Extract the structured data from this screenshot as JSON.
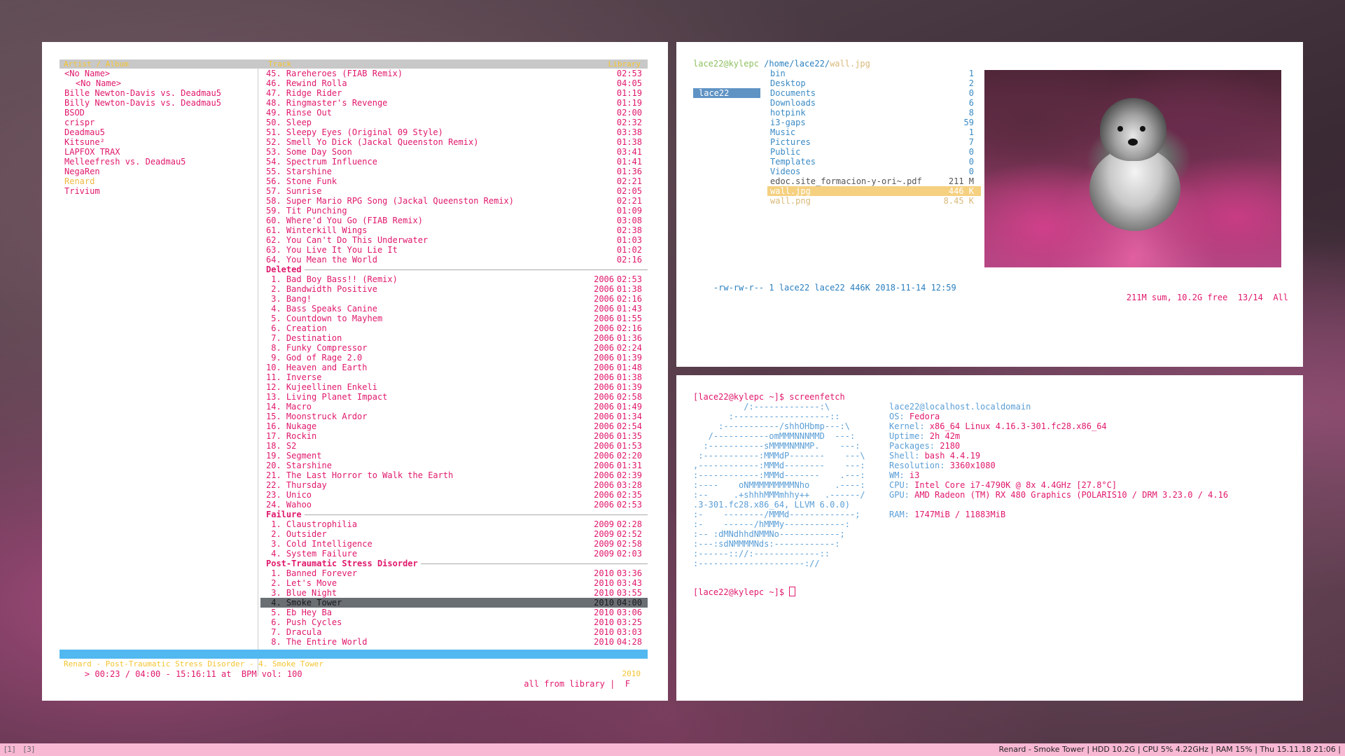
{
  "cmus": {
    "header_left": "Artist / Album",
    "header_mid": "Track",
    "header_right": "Library",
    "artists": [
      {
        "name": "<No Name>",
        "indent": false,
        "selected": false
      },
      {
        "name": "<No Name>",
        "indent": true,
        "selected": false
      },
      {
        "name": "Bille Newton-Davis vs. Deadmau5",
        "indent": false,
        "selected": false
      },
      {
        "name": "Billy Newton-Davis vs. Deadmau5",
        "indent": false,
        "selected": false
      },
      {
        "name": "BSOD",
        "indent": false,
        "selected": false
      },
      {
        "name": "crispr",
        "indent": false,
        "selected": false
      },
      {
        "name": "Deadmau5",
        "indent": false,
        "selected": false
      },
      {
        "name": "Kitsune²",
        "indent": false,
        "selected": false
      },
      {
        "name": "LAPFOX TRAX",
        "indent": false,
        "selected": false
      },
      {
        "name": "Melleefresh vs. Deadmau5",
        "indent": false,
        "selected": false
      },
      {
        "name": "NegaRen",
        "indent": false,
        "selected": false
      },
      {
        "name": "Renard",
        "indent": false,
        "selected": true
      },
      {
        "name": "Trivium",
        "indent": false,
        "selected": false
      }
    ],
    "tracks": [
      {
        "kind": "track",
        "title": "45. Rareheroes (FIAB Remix)",
        "year": "",
        "dur": "02:53"
      },
      {
        "kind": "track",
        "title": "46. Rewind Rolla",
        "year": "",
        "dur": "04:05"
      },
      {
        "kind": "track",
        "title": "47. Ridge Rider",
        "year": "",
        "dur": "01:19"
      },
      {
        "kind": "track",
        "title": "48. Ringmaster's Revenge",
        "year": "",
        "dur": "01:19"
      },
      {
        "kind": "track",
        "title": "49. Rinse Out",
        "year": "",
        "dur": "02:00"
      },
      {
        "kind": "track",
        "title": "50. Sleep",
        "year": "",
        "dur": "02:32"
      },
      {
        "kind": "track",
        "title": "51. Sleepy Eyes (Original 09 Style)",
        "year": "",
        "dur": "03:38"
      },
      {
        "kind": "track",
        "title": "52. Smell Yo Dick (Jackal Queenston Remix)",
        "year": "",
        "dur": "01:38"
      },
      {
        "kind": "track",
        "title": "53. Some Day Soon",
        "year": "",
        "dur": "03:41"
      },
      {
        "kind": "track",
        "title": "54. Spectrum Influence",
        "year": "",
        "dur": "01:41"
      },
      {
        "kind": "track",
        "title": "55. Starshine",
        "year": "",
        "dur": "01:36"
      },
      {
        "kind": "track",
        "title": "56. Stone Funk",
        "year": "",
        "dur": "02:21"
      },
      {
        "kind": "track",
        "title": "57. Sunrise",
        "year": "",
        "dur": "02:05"
      },
      {
        "kind": "track",
        "title": "58. Super Mario RPG Song (Jackal Queenston Remix)",
        "year": "",
        "dur": "02:21"
      },
      {
        "kind": "track",
        "title": "59. Tit Punching",
        "year": "",
        "dur": "01:09"
      },
      {
        "kind": "track",
        "title": "60. Where'd You Go (FIAB Remix)",
        "year": "",
        "dur": "03:08"
      },
      {
        "kind": "track",
        "title": "61. Winterkill Wings",
        "year": "",
        "dur": "02:38"
      },
      {
        "kind": "track",
        "title": "62. You Can't Do This Underwater",
        "year": "",
        "dur": "01:03"
      },
      {
        "kind": "track",
        "title": "63. You Live It You Lie It",
        "year": "",
        "dur": "01:02"
      },
      {
        "kind": "track",
        "title": "64. You Mean the World",
        "year": "",
        "dur": "02:16"
      },
      {
        "kind": "group",
        "title": "Deleted"
      },
      {
        "kind": "track",
        "title": " 1. Bad Boy Bass!! (Remix)",
        "year": "2006",
        "dur": "02:53"
      },
      {
        "kind": "track",
        "title": " 2. Bandwidth Positive",
        "year": "2006",
        "dur": "01:38"
      },
      {
        "kind": "track",
        "title": " 3. Bang!",
        "year": "2006",
        "dur": "02:16"
      },
      {
        "kind": "track",
        "title": " 4. Bass Speaks Canine",
        "year": "2006",
        "dur": "01:43"
      },
      {
        "kind": "track",
        "title": " 5. Countdown to Mayhem",
        "year": "2006",
        "dur": "01:55"
      },
      {
        "kind": "track",
        "title": " 6. Creation",
        "year": "2006",
        "dur": "02:16"
      },
      {
        "kind": "track",
        "title": " 7. Destination",
        "year": "2006",
        "dur": "01:36"
      },
      {
        "kind": "track",
        "title": " 8. Funky Compressor",
        "year": "2006",
        "dur": "02:24"
      },
      {
        "kind": "track",
        "title": " 9. God of Rage 2.0",
        "year": "2006",
        "dur": "01:39"
      },
      {
        "kind": "track",
        "title": "10. Heaven and Earth",
        "year": "2006",
        "dur": "01:48"
      },
      {
        "kind": "track",
        "title": "11. Inverse",
        "year": "2006",
        "dur": "01:38"
      },
      {
        "kind": "track",
        "title": "12. Kujeellinen Enkeli",
        "year": "2006",
        "dur": "01:39"
      },
      {
        "kind": "track",
        "title": "13. Living Planet Impact",
        "year": "2006",
        "dur": "02:58"
      },
      {
        "kind": "track",
        "title": "14. Macro",
        "year": "2006",
        "dur": "01:49"
      },
      {
        "kind": "track",
        "title": "15. Moonstruck Ardor",
        "year": "2006",
        "dur": "01:34"
      },
      {
        "kind": "track",
        "title": "16. Nukage",
        "year": "2006",
        "dur": "02:54"
      },
      {
        "kind": "track",
        "title": "17. Rockin",
        "year": "2006",
        "dur": "01:35"
      },
      {
        "kind": "track",
        "title": "18. S2",
        "year": "2006",
        "dur": "01:53"
      },
      {
        "kind": "track",
        "title": "19. Segment",
        "year": "2006",
        "dur": "02:20"
      },
      {
        "kind": "track",
        "title": "20. Starshine",
        "year": "2006",
        "dur": "01:31"
      },
      {
        "kind": "track",
        "title": "21. The Last Horror to Walk the Earth",
        "year": "2006",
        "dur": "02:39"
      },
      {
        "kind": "track",
        "title": "22. Thursday",
        "year": "2006",
        "dur": "03:28"
      },
      {
        "kind": "track",
        "title": "23. Unico",
        "year": "2006",
        "dur": "02:35"
      },
      {
        "kind": "track",
        "title": "24. Wahoo",
        "year": "2006",
        "dur": "02:53"
      },
      {
        "kind": "group",
        "title": "Failure"
      },
      {
        "kind": "track",
        "title": " 1. Claustrophilia",
        "year": "2009",
        "dur": "02:28"
      },
      {
        "kind": "track",
        "title": " 2. Outsider",
        "year": "2009",
        "dur": "02:52"
      },
      {
        "kind": "track",
        "title": " 3. Cold Intelligence",
        "year": "2009",
        "dur": "02:58"
      },
      {
        "kind": "track",
        "title": " 4. System Failure",
        "year": "2009",
        "dur": "02:03"
      },
      {
        "kind": "group",
        "title": "Post-Traumatic Stress Disorder"
      },
      {
        "kind": "track",
        "title": " 1. Banned Forever",
        "year": "2010",
        "dur": "03:36"
      },
      {
        "kind": "track",
        "title": " 2. Let's Move",
        "year": "2010",
        "dur": "03:43"
      },
      {
        "kind": "track",
        "title": " 3. Blue Night",
        "year": "2010",
        "dur": "03:55"
      },
      {
        "kind": "track",
        "title": " 4. Smoke Tower",
        "year": "2010",
        "dur": "04:00",
        "current": true
      },
      {
        "kind": "track",
        "title": " 5. Eb Hey Ba",
        "year": "2010",
        "dur": "03:06"
      },
      {
        "kind": "track",
        "title": " 6. Push Cycles",
        "year": "2010",
        "dur": "03:25"
      },
      {
        "kind": "track",
        "title": " 7. Dracula",
        "year": "2010",
        "dur": "03:03"
      },
      {
        "kind": "track",
        "title": " 8. The Entire World",
        "year": "2010",
        "dur": "04:28"
      }
    ],
    "status_left": "Renard - Post-Traumatic Stress Disorder - 4. Smoke Tower",
    "status_right": "2010",
    "cmd_left": "> 00:23 / 04:00 - 15:16:11 at  BPM vol: 100",
    "cmd_right": "all from library |  F"
  },
  "ranger": {
    "user_host": "lace22@kylepc",
    "path_dir": "/home/lace22/",
    "path_file": "wall.jpg",
    "parent_selected": "lace22",
    "items": [
      {
        "name": "bin",
        "size": "1",
        "type": "dir"
      },
      {
        "name": "Desktop",
        "size": "2",
        "type": "dir"
      },
      {
        "name": "Documents",
        "size": "0",
        "type": "dir"
      },
      {
        "name": "Downloads",
        "size": "6",
        "type": "dir"
      },
      {
        "name": "hotpink",
        "size": "8",
        "type": "dir"
      },
      {
        "name": "i3-gaps",
        "size": "59",
        "type": "dir"
      },
      {
        "name": "Music",
        "size": "1",
        "type": "dir"
      },
      {
        "name": "Pictures",
        "size": "7",
        "type": "dir"
      },
      {
        "name": "Public",
        "size": "0",
        "type": "dir"
      },
      {
        "name": "Templates",
        "size": "0",
        "type": "dir"
      },
      {
        "name": "Videos",
        "size": "0",
        "type": "dir"
      },
      {
        "name": "edoc.site_formacion-y-ori~.pdf",
        "size": "211 M",
        "type": "pdf"
      },
      {
        "name": "wall.jpg",
        "size": "446 K",
        "type": "file",
        "selected": true
      },
      {
        "name": "wall.png",
        "size": "8.45 K",
        "type": "file"
      }
    ],
    "bottom_left": "-rw-rw-r-- 1 lace22 lace22 446K 2018-11-14 12:59",
    "bottom_right": "211M sum, 10.2G free  13/14  All"
  },
  "terminal": {
    "prompt1": "[lace22@kylepc ~]$ screenfetch",
    "logo": [
      "          /:-------------:\\",
      "       :-------------------::",
      "     :-----------/shhOHbmp---:\\",
      "   /-----------omMMMNNNMMD  ---:",
      "  :-----------sMMMMNMNMP.    ---:",
      " :-----------:MMMdP-------    ---\\",
      ",------------:MMMd--------    ---:",
      ":------------:MMMd-------    .---:",
      ":----    oNMMMMMMMMMNho     .----:",
      ":--     .+shhhMMMmhhy++   .------/",
      ".3-301.fc28.x86_64, LLVM 6.0.0)",
      ":-    --------/MMMd-------------;",
      ":-    ------/hMMMy------------:",
      ":-- :dMNdhhdNMMNo------------;",
      ":---:sdNMMMMNds:------------:",
      ":------:://:-------------::",
      ":---------------------://"
    ],
    "info": [
      {
        "k": "",
        "v": "lace22@localhost.localdomain",
        "head": true
      },
      {
        "k": "OS: ",
        "v": "Fedora"
      },
      {
        "k": "Kernel: ",
        "v": "x86_64 Linux 4.16.3-301.fc28.x86_64"
      },
      {
        "k": "Uptime: ",
        "v": "2h 42m"
      },
      {
        "k": "Packages: ",
        "v": "2180"
      },
      {
        "k": "Shell: ",
        "v": "bash 4.4.19"
      },
      {
        "k": "Resolution: ",
        "v": "3360x1080"
      },
      {
        "k": "WM: ",
        "v": "i3"
      },
      {
        "k": "CPU: ",
        "v": "Intel Core i7-4790K @ 8x 4.4GHz [27.8°C]"
      },
      {
        "k": "GPU: ",
        "v": "AMD Radeon (TM) RX 480 Graphics (POLARIS10 / DRM 3.23.0 / 4.16"
      },
      {
        "k": "",
        "v": ""
      },
      {
        "k": "RAM: ",
        "v": "1747MiB / 11883MiB"
      }
    ],
    "prompt2": "[lace22@kylepc ~]$ "
  },
  "bar": {
    "workspaces": [
      "[1]",
      "[3]"
    ],
    "status": "Renard - Smoke Tower | HDD 10.2G | CPU 5% 4.22GHz | RAM 15% | Thu 15.11.18 21:06 |"
  }
}
